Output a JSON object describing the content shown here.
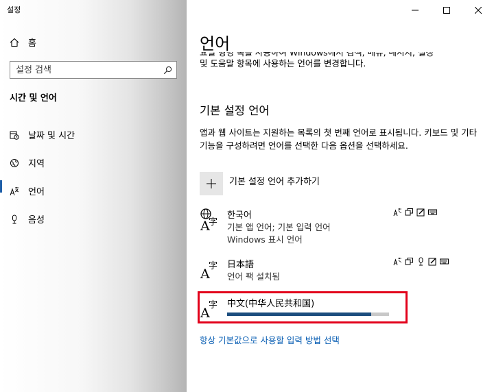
{
  "window": {
    "title": "설정",
    "minimize_icon": "minimize-icon",
    "maximize_icon": "maximize-icon",
    "close_icon": "close-icon"
  },
  "sidebar": {
    "home_label": "홈",
    "search_placeholder": "설정 검색",
    "section_title": "시간 및 언어",
    "items": [
      {
        "label": "날짜 및 시간",
        "icon": "calendar-clock-icon"
      },
      {
        "label": "지역",
        "icon": "globe-region-icon"
      },
      {
        "label": "언어",
        "icon": "language-icon",
        "active": true
      },
      {
        "label": "음성",
        "icon": "microphone-icon"
      }
    ]
  },
  "main": {
    "page_title": "언어",
    "partial_line1": "요일 형명 목을 사용하여 Windows에서 검색, 메뉴, 메시지, 설정",
    "partial_line2": "및 도움말 항목에 사용하는 언어를 변경합니다.",
    "section_title": "기본 설정 언어",
    "description": "앱과 웹 사이트는 지원하는 목록의 첫 번째 언어로 표시됩니다. 키보드 및 기타 기능을 구성하려면 언어를 선택한 다음 옵션을 선택하세요.",
    "add_language_label": "기본 설정 언어 추가하기",
    "languages": [
      {
        "name": "한국어",
        "sub1": "기본 앱 언어; 기본 입력 언어",
        "sub2": "Windows 표시 언어"
      },
      {
        "name": "日本語",
        "sub1": "언어 팩 설치됨"
      },
      {
        "name": "中文(中华人民共和国)",
        "progress": 0.89
      }
    ],
    "link_text": "항상 기본값으로 사용할 입력 방법 선택"
  },
  "colors": {
    "accent": "#1f5fa8",
    "link": "#0a5fb4",
    "highlight_border": "#e2001a",
    "progress_fill": "#1b4d7e"
  }
}
